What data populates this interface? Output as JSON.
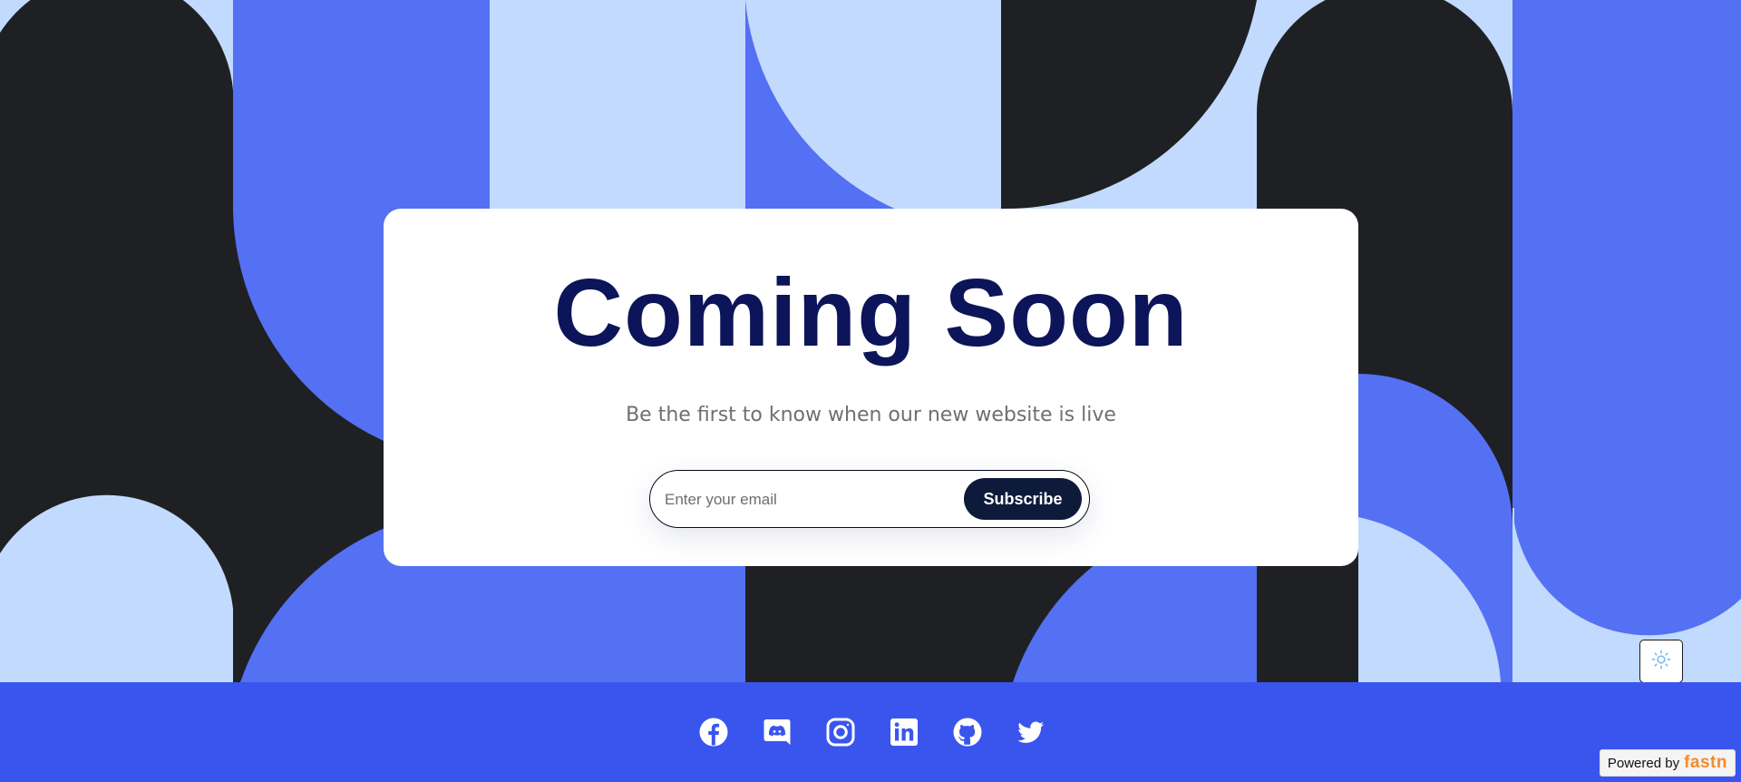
{
  "hero": {
    "title": "Coming Soon",
    "subtitle": "Be the first to know when our new website is live"
  },
  "subscribe": {
    "placeholder": "Enter your email",
    "value": "",
    "button_label": "Subscribe"
  },
  "theme_toggle": {
    "icon": "sun-icon"
  },
  "footer": {
    "social_icons": [
      "facebook-icon",
      "discord-icon",
      "instagram-icon",
      "linkedin-icon",
      "github-icon",
      "twitter-icon"
    ]
  },
  "badge": {
    "prefix": "Powered by",
    "brand": "fastn"
  },
  "colors": {
    "light_blue": "#c2dafd",
    "mid_blue": "#5470f3",
    "dark": "#1f2024",
    "footer_blue": "#3a55ee",
    "title_navy": "#0c1559",
    "button_dark": "#0e1a3a",
    "brand_orange": "#f58b2a"
  }
}
